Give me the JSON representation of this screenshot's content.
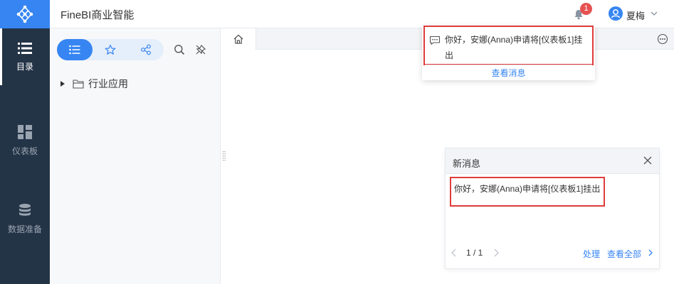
{
  "app": {
    "title": "FineBI商业智能"
  },
  "header": {
    "notification_count": "1",
    "user_name": "夏梅"
  },
  "nav": {
    "items": [
      {
        "label": "目录",
        "icon": "list-icon",
        "active": true
      },
      {
        "label": "仪表板",
        "icon": "dashboard-icon",
        "active": false
      },
      {
        "label": "数据准备",
        "icon": "database-icon",
        "active": false
      }
    ]
  },
  "catalog": {
    "tree": [
      {
        "label": "行业应用"
      }
    ]
  },
  "notification_popup": {
    "message": "你好，安娜(Anna)申请将[仪表板1]挂出",
    "link": "查看消息"
  },
  "message_card": {
    "title": "新消息",
    "body": "你好，安娜(Anna)申请将[仪表板1]挂出",
    "pager": "1 / 1",
    "action_handle": "处理",
    "action_view_all": "查看全部"
  },
  "colors": {
    "accent": "#3685f2",
    "nav_bg": "#243447",
    "highlight_border": "#e03b3b",
    "badge": "#e65251"
  }
}
